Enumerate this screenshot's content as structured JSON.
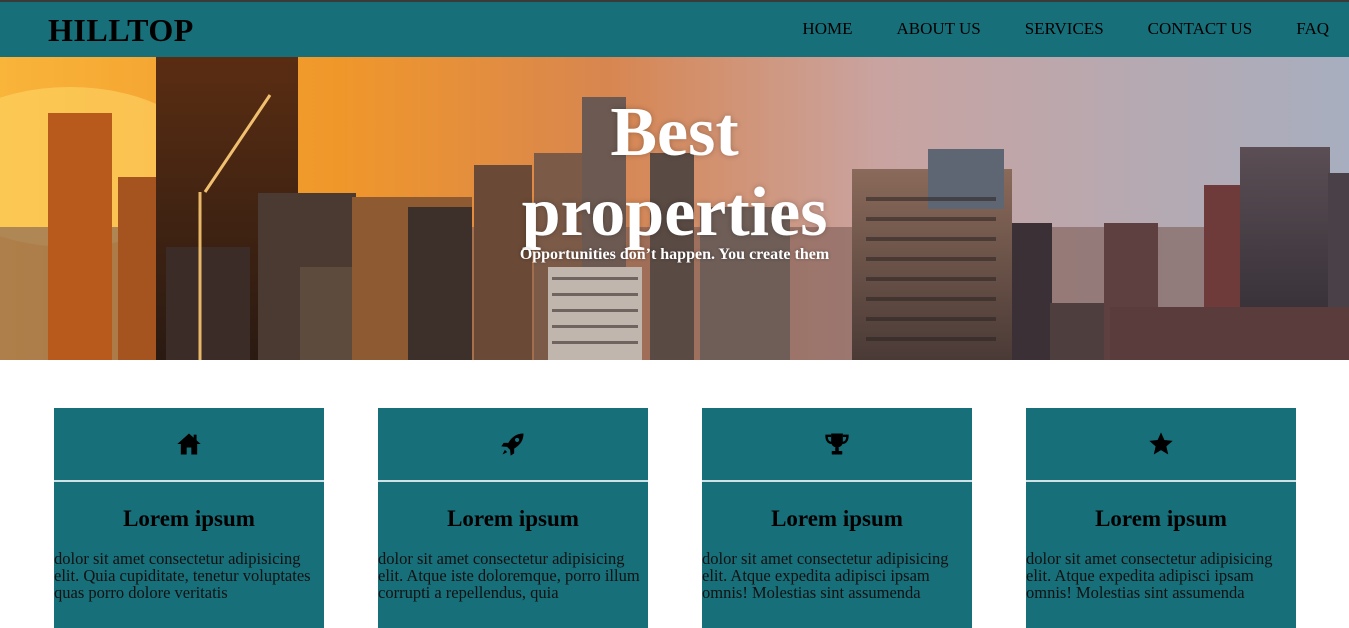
{
  "header": {
    "logo": "HILLTOP",
    "nav": [
      "HOME",
      "ABOUT US",
      "SERVICES",
      "CONTACT US",
      "FAQ"
    ],
    "background_color": "#176f7a"
  },
  "hero": {
    "title": "Best properties",
    "subtitle": "Opportunities don’t happen. You create them"
  },
  "cards": [
    {
      "icon": "home-icon",
      "title": "Lorem ipsum",
      "text": "dolor sit amet consectetur adipisicing elit. Quia cupiditate, tenetur voluptates quas porro dolore veritatis"
    },
    {
      "icon": "rocket-icon",
      "title": "Lorem ipsum",
      "text": "dolor sit amet consectetur adipisicing elit. Atque iste doloremque, porro illum corrupti a repellendus, quia"
    },
    {
      "icon": "trophy-icon",
      "title": "Lorem ipsum",
      "text": "dolor sit amet consectetur adipisicing elit. Atque expedita adipisci ipsam omnis! Molestias sint assumenda"
    },
    {
      "icon": "star-icon",
      "title": "Lorem ipsum",
      "text": "dolor sit amet consectetur adipisicing elit. Atque expedita adipisci ipsam omnis! Molestias sint assumenda"
    }
  ]
}
